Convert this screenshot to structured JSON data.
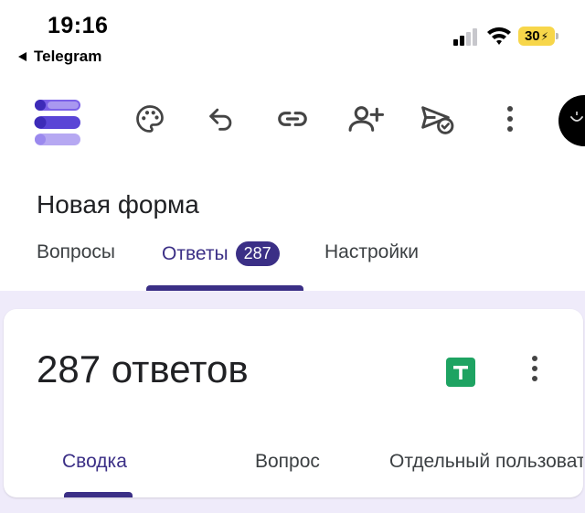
{
  "status_bar": {
    "time": "19:16",
    "back_app": "Telegram",
    "battery": "30",
    "battery_color": "#f7d64a"
  },
  "toolbar": {
    "icons": [
      "forms-logo",
      "palette-icon",
      "undo-icon",
      "link-icon",
      "add-person-icon",
      "send-icon",
      "more-vert-icon",
      "avatar"
    ]
  },
  "form": {
    "title": "Новая форма"
  },
  "tabs": {
    "questions": "Вопросы",
    "responses": "Ответы",
    "responses_count": "287",
    "settings": "Настройки"
  },
  "summary": {
    "count_text": "287 ответов",
    "tabs": {
      "summary": "Сводка",
      "question": "Вопрос",
      "individual": "Отдельный пользователь"
    }
  },
  "colors": {
    "accent": "#3b2f86",
    "content_bg": "#efebfa",
    "sheets_green": "#1ea362",
    "logo_purple": "#7b61e8"
  }
}
